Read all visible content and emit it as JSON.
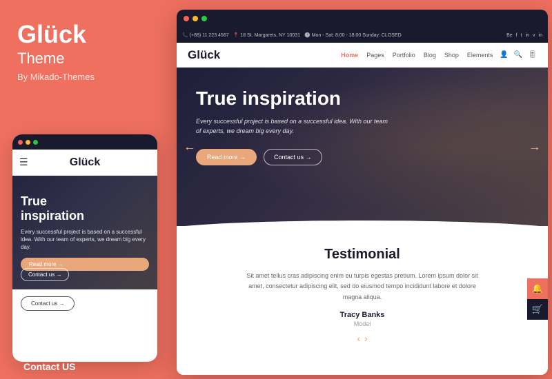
{
  "left": {
    "brand": {
      "title": "Glück",
      "subtitle": "Theme",
      "by": "By Mikado-Themes"
    },
    "mobile": {
      "dots": [
        "red",
        "yellow",
        "green"
      ],
      "logo": "Glück",
      "hero": {
        "title": "True\ninspiration",
        "description": "Every successful project is based on a successful idea. With our team of experts, we dream big every day.",
        "read_more": "Read more →",
        "contact_us": "Contact us →"
      },
      "bottom_btn": "Contact us →"
    },
    "contact_label": "Contact US"
  },
  "browser": {
    "dots": [
      "red",
      "yellow",
      "green"
    ],
    "address_bar": {
      "phone": "(+88) 11 223 4567",
      "address": "18 St. Margarets, NY 10031",
      "hours": "Mon - Sat: 8:00 - 18:00 Sunday: CLOSED",
      "social": [
        "Be",
        "f",
        "t",
        "in",
        "v",
        "in"
      ]
    },
    "navbar": {
      "logo": "Glück",
      "links": [
        "Home",
        "Pages",
        "Portfolio",
        "Blog",
        "Shop",
        "Elements"
      ]
    },
    "hero": {
      "title": "True inspiration",
      "description": "Every successful project is based on a successful idea. With our team of experts, we dream big every day.",
      "read_more_btn": "Read more →",
      "contact_btn": "Contact us →"
    },
    "testimonial": {
      "title": "Testimonial",
      "text": "Sit amet tellus cras adipiscing enim eu turpis egestas pretium. Lorem ipsum dolor sit amet, consectetur adipiscing elit, sed do eiusmod tempo incididunt labore et dolore magna aliqua.",
      "name": "Tracy Banks",
      "role": "Model",
      "prev": "‹",
      "next": "›"
    },
    "side_icons": {
      "top": "🔔",
      "cart": "🛒"
    }
  }
}
